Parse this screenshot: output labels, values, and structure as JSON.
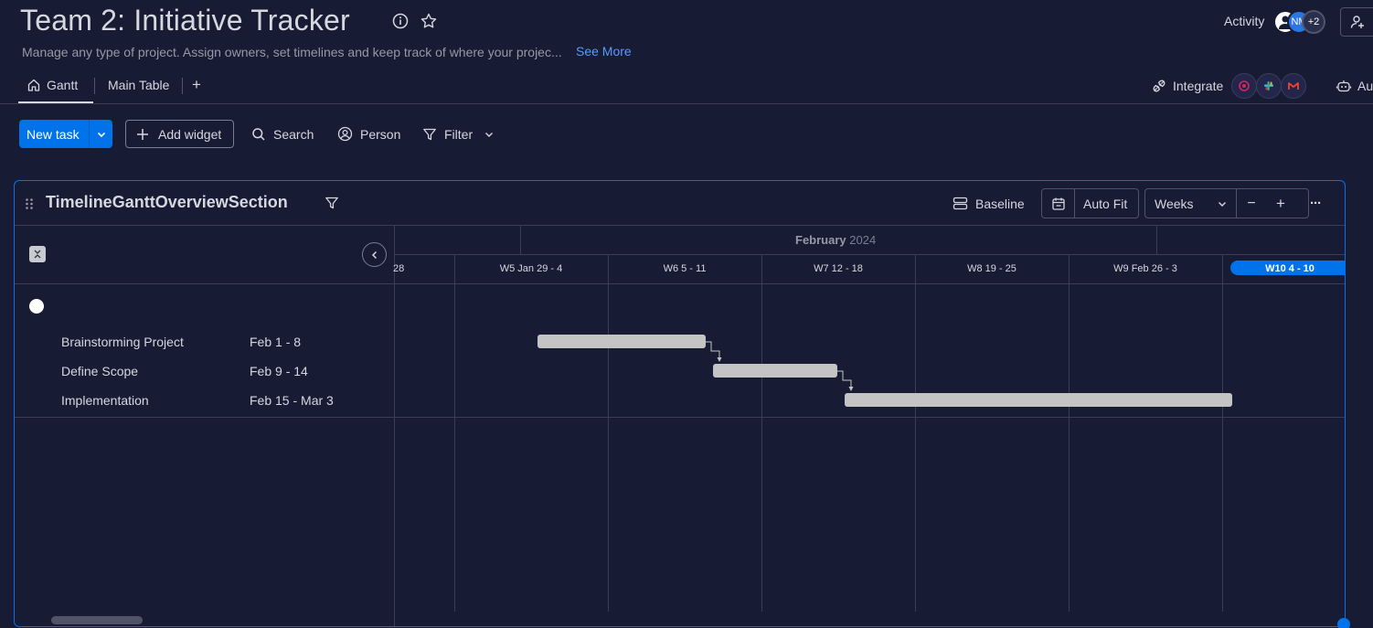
{
  "header": {
    "title": "Team 2: Initiative Tracker",
    "description": "Manage any type of project. Assign owners, set timelines and keep track of where your projec...",
    "see_more": "See More",
    "activity": "Activity",
    "avatars": {
      "initials": "NM",
      "more": "+2"
    },
    "icons": [
      "info-icon",
      "star-icon",
      "invite-icon"
    ]
  },
  "tabs": {
    "items": [
      {
        "label": "Gantt",
        "icon": "home-icon",
        "active": true
      },
      {
        "label": "Main Table",
        "active": false
      }
    ],
    "add": "+",
    "integrate": "Integrate",
    "automate": "Au"
  },
  "toolbar": {
    "new_task": "New task",
    "add_widget": "Add widget",
    "search": "Search",
    "person": "Person",
    "filter": "Filter"
  },
  "widget": {
    "title": "TimelineGanttOverviewSection",
    "baseline": "Baseline",
    "auto_fit": "Auto Fit",
    "scale": "Weeks",
    "zoom_out": "−",
    "zoom_in": "+",
    "more": "···",
    "month": {
      "name": "February",
      "year": "2024"
    },
    "weeks": [
      {
        "label": "28",
        "partial": true
      },
      {
        "label": "W5 Jan 29 - 4"
      },
      {
        "label": "W6 5 - 11"
      },
      {
        "label": "W7 12 - 18"
      },
      {
        "label": "W8 19 - 25"
      },
      {
        "label": "W9 Feb 26 - 3"
      },
      {
        "label": "W10 4 - 10",
        "current": true
      }
    ],
    "tasks": [
      {
        "name": "Brainstorming Project",
        "date": "Feb 1 - 8",
        "start": "2024-02-01",
        "end": "2024-02-08"
      },
      {
        "name": "Define Scope",
        "date": "Feb 9 - 14",
        "start": "2024-02-09",
        "end": "2024-02-14"
      },
      {
        "name": "Implementation",
        "date": "Feb 15 - Mar 3",
        "start": "2024-02-15",
        "end": "2024-03-03"
      }
    ],
    "dependencies": [
      [
        0,
        1
      ],
      [
        1,
        2
      ]
    ]
  },
  "colors": {
    "background": "#181b34",
    "primary": "#0073ea",
    "bar": "#c4c4c4",
    "text": "#d5d8df",
    "muted": "#9699a6"
  }
}
